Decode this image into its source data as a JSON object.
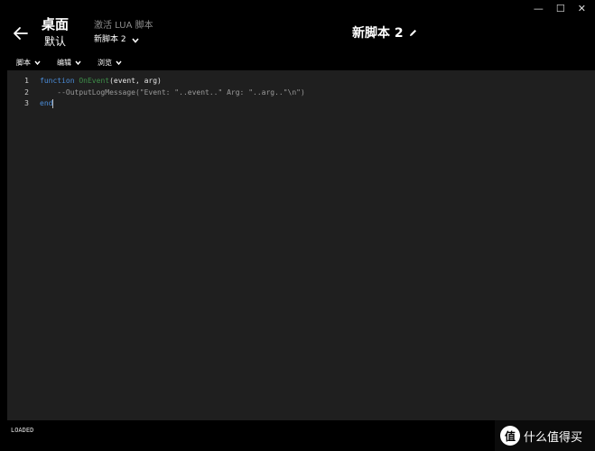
{
  "window": {
    "minimize": "—",
    "maximize": "☐",
    "close": "✕"
  },
  "header": {
    "title": "桌面",
    "subtitle": "默认",
    "mode_label": "激活 LUA 脚本",
    "mode_value": "新脚本 2",
    "script_title": "新脚本 2"
  },
  "menubar": {
    "items": [
      "脚本",
      "编辑",
      "浏览"
    ]
  },
  "editor": {
    "line_numbers": [
      "1",
      "2",
      "3"
    ],
    "line1": {
      "keyword": "function",
      "name": "OnEvent",
      "params": "(event, arg)"
    },
    "line2": {
      "comment": "    --OutputLogMessage(\"Event: \"..event..\" Arg: \"..arg..\"\\n\")"
    },
    "line3": {
      "keyword": "end"
    }
  },
  "status": {
    "text": "LOADED"
  },
  "watermark": {
    "text": "什么值得买",
    "logo": "值"
  }
}
